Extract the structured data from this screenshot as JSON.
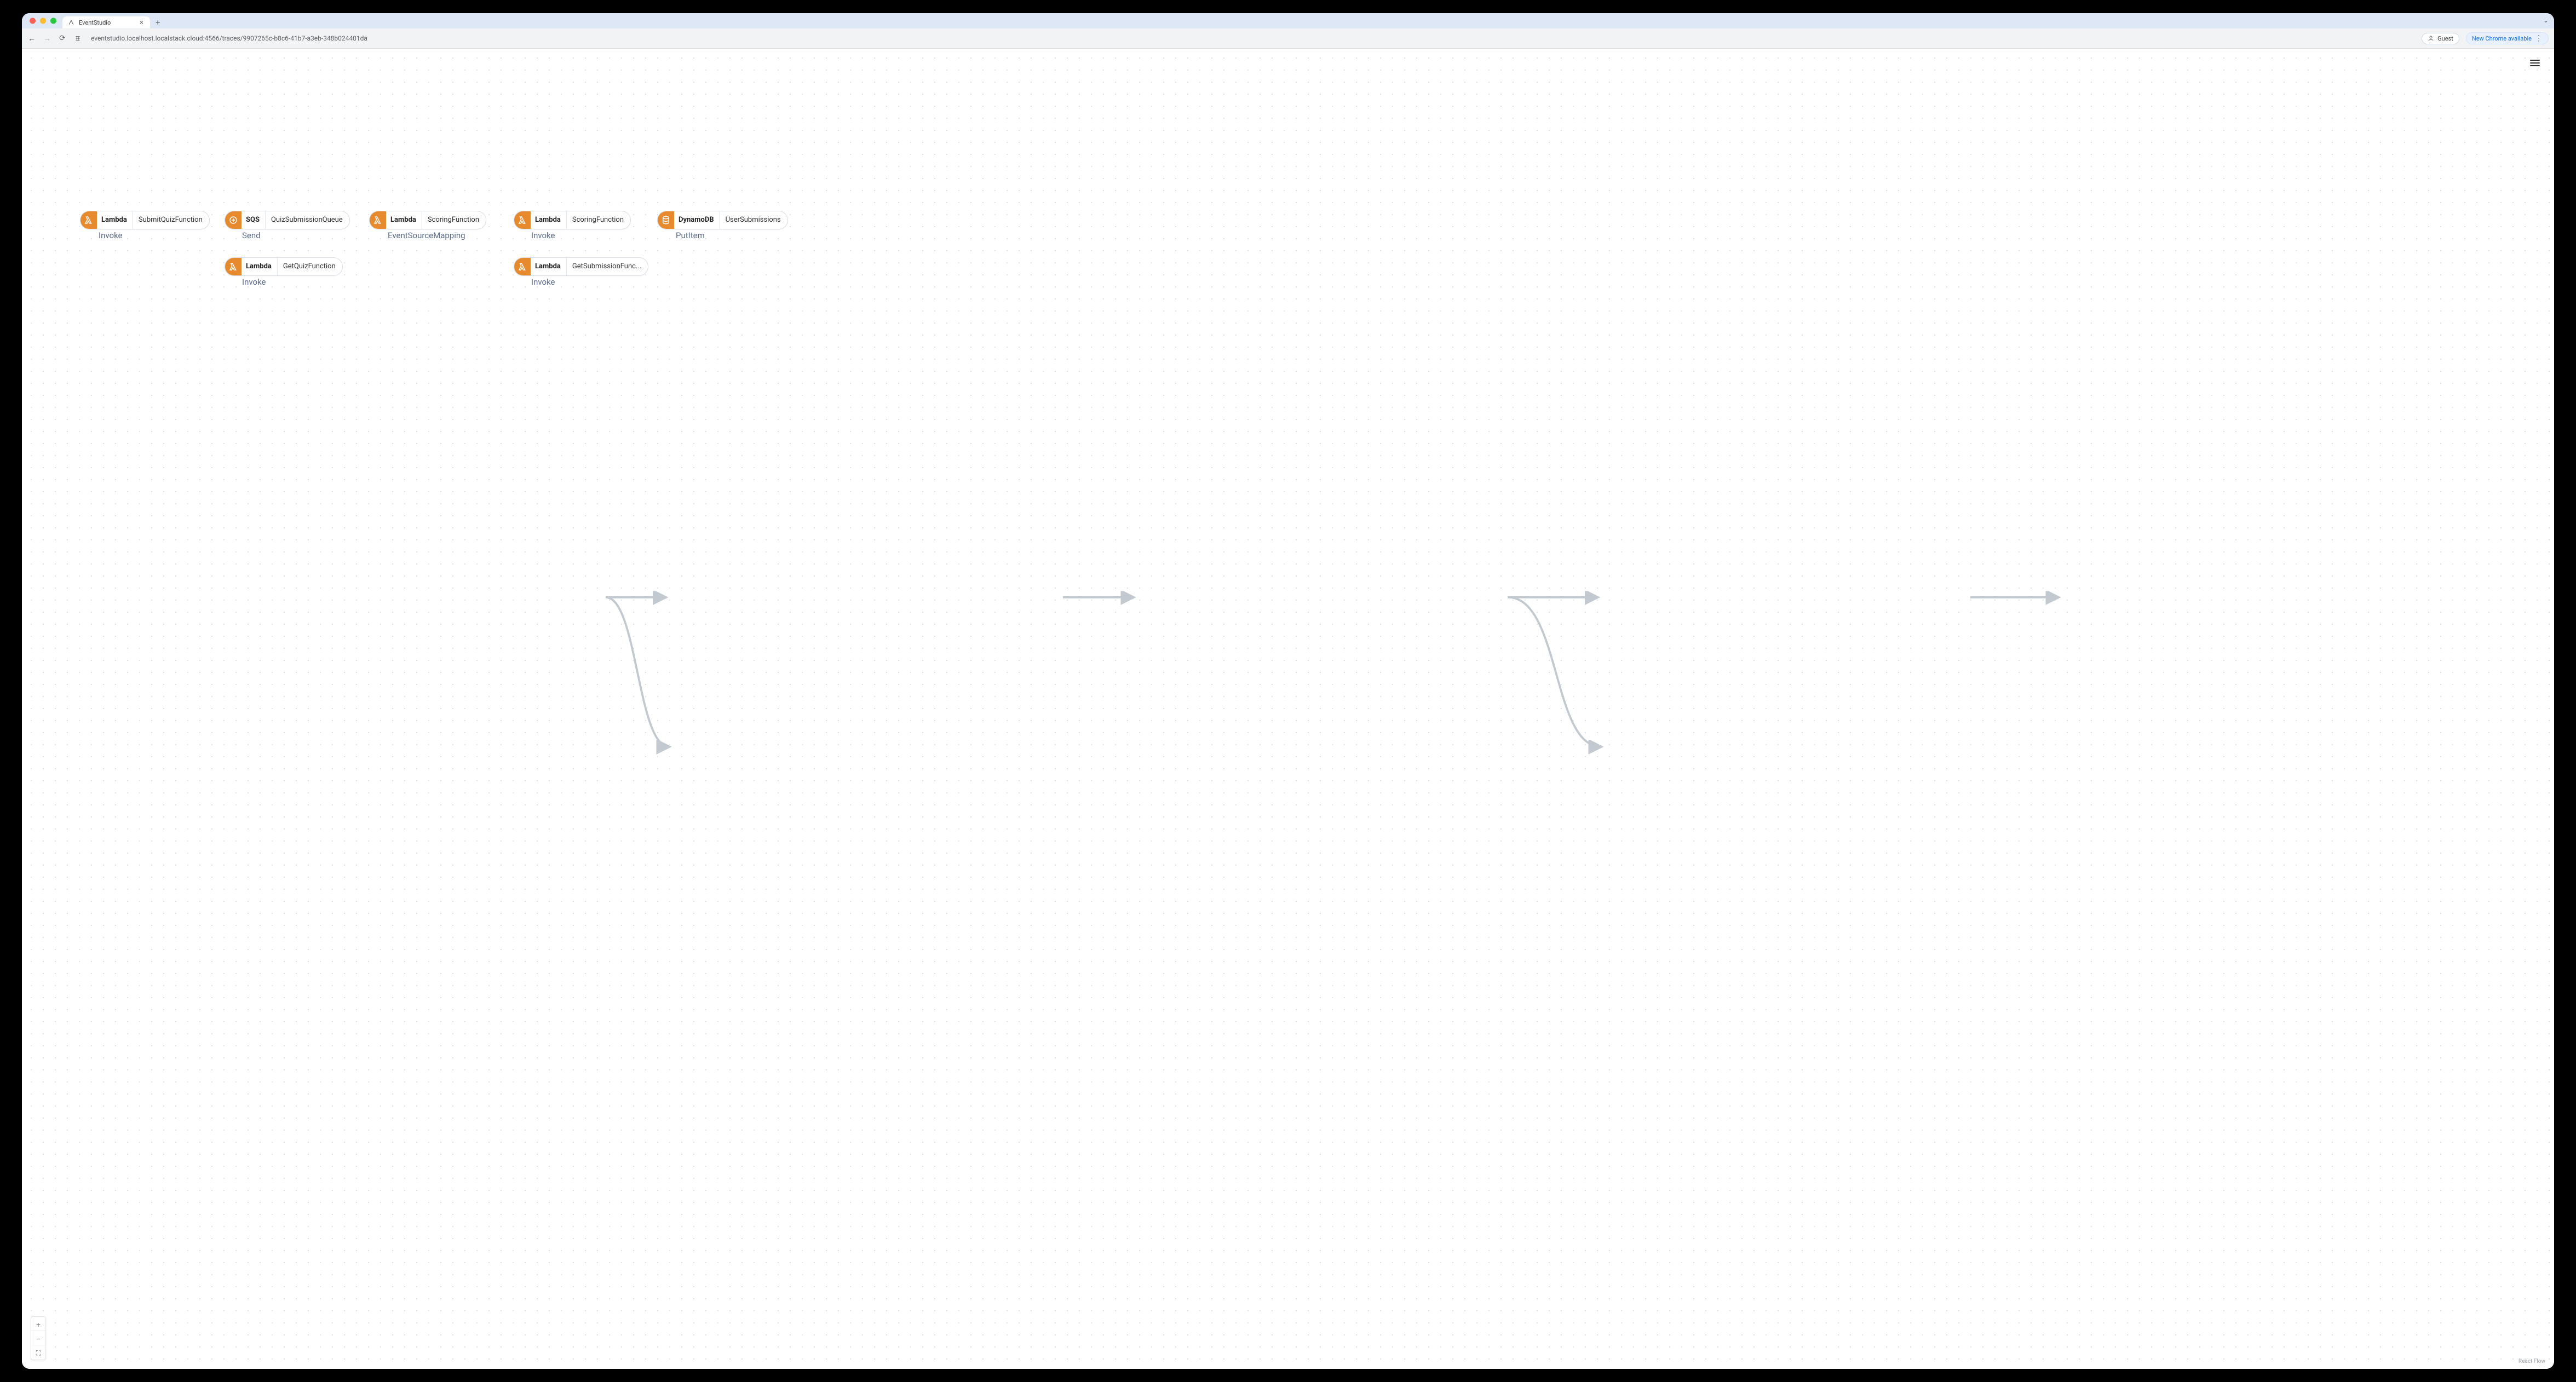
{
  "browser": {
    "tab_title": "EventStudio",
    "url": "eventstudio.localhost.localstack.cloud:4566/traces/9907265c-b8c6-41b7-a3eb-348b024401da",
    "guest_label": "Guest",
    "promo_label": "New Chrome available"
  },
  "canvas": {
    "attribution": "React Flow",
    "controls": {
      "zoom_in": "+",
      "zoom_out": "−",
      "fit": "⛶"
    }
  },
  "nodes": {
    "n1": {
      "service": "Lambda",
      "resource": "SubmitQuizFunction",
      "caption": "Invoke"
    },
    "n2": {
      "service": "SQS",
      "resource": "QuizSubmissionQueue",
      "caption": "Send"
    },
    "n3": {
      "service": "Lambda",
      "resource": "GetQuizFunction",
      "caption": "Invoke"
    },
    "n4": {
      "service": "Lambda",
      "resource": "ScoringFunction",
      "caption": "EventSourceMapping"
    },
    "n5": {
      "service": "Lambda",
      "resource": "ScoringFunction",
      "caption": "Invoke"
    },
    "n6": {
      "service": "Lambda",
      "resource": "GetSubmissionFunc...",
      "caption": "Invoke"
    },
    "n7": {
      "service": "DynamoDB",
      "resource": "UserSubmissions",
      "caption": "PutItem"
    }
  },
  "icons": {
    "lambda": "lambda",
    "sqs": "sqs",
    "dynamodb": "dynamodb"
  }
}
